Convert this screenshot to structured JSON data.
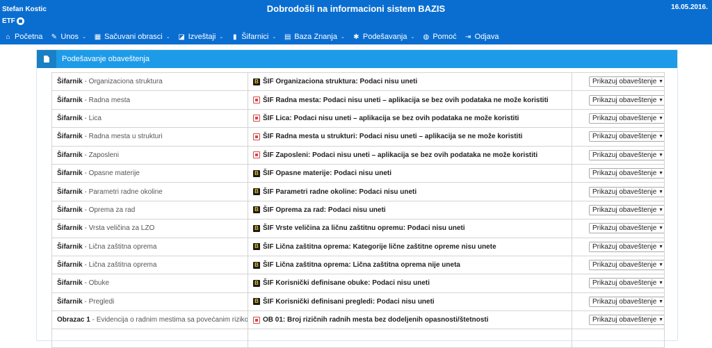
{
  "header": {
    "user_name": "Stefan Kostic",
    "org": "ETF",
    "title": "Dobrodošli na informacioni sistem BAZIS",
    "date": "16.05.2016."
  },
  "nav": [
    {
      "label": "Početna",
      "icon": "home-icon",
      "glyph": "⌂",
      "dropdown": false
    },
    {
      "label": "Unos",
      "icon": "pencil-icon",
      "glyph": "✎",
      "dropdown": true
    },
    {
      "label": "Sačuvani obrasci",
      "icon": "table-icon",
      "glyph": "▦",
      "dropdown": true
    },
    {
      "label": "Izveštaji",
      "icon": "chart-icon",
      "glyph": "◪",
      "dropdown": true
    },
    {
      "label": "Šifarnici",
      "icon": "book-icon",
      "glyph": "▮",
      "dropdown": true
    },
    {
      "label": "Baza Znanja",
      "icon": "database-icon",
      "glyph": "▤",
      "dropdown": true
    },
    {
      "label": "Podešavanja",
      "icon": "gear-icon",
      "glyph": "✱",
      "dropdown": true
    },
    {
      "label": "Pomoć",
      "icon": "globe-icon",
      "glyph": "◍",
      "dropdown": false
    },
    {
      "label": "Odjava",
      "icon": "logout-icon",
      "glyph": "⇥",
      "dropdown": false
    }
  ],
  "panel": {
    "title": "Podešavanje obaveštenja"
  },
  "rows": [
    {
      "group": "Šifarnik",
      "name": "Organizaciona struktura",
      "badge": "b",
      "message": "ŠIF Organizaciona struktura: Podaci nisu uneti",
      "option": "Prikazuj obaveštenje"
    },
    {
      "group": "Šifarnik",
      "name": "Radna mesta",
      "badge": "r",
      "message": "ŠIF Radna mesta: Podaci nisu uneti – aplikacija se bez ovih podataka ne može koristiti",
      "option": "Prikazuj obaveštenje"
    },
    {
      "group": "Šifarnik",
      "name": "Lica",
      "badge": "r",
      "message": "ŠIF Lica: Podaci nisu uneti – aplikacija se bez ovih podataka ne može koristiti",
      "option": "Prikazuj obaveštenje"
    },
    {
      "group": "Šifarnik",
      "name": "Radna mesta u strukturi",
      "badge": "r",
      "message": "ŠIF Radna mesta u strukturi: Podaci nisu uneti – aplikacija se ne može koristiti",
      "option": "Prikazuj obaveštenje"
    },
    {
      "group": "Šifarnik",
      "name": "Zaposleni",
      "badge": "r",
      "message": "ŠIF Zaposleni: Podaci nisu uneti – aplikacija se bez ovih podataka ne može koristiti",
      "option": "Prikazuj obaveštenje"
    },
    {
      "group": "Šifarnik",
      "name": "Opasne materije",
      "badge": "b",
      "message": "ŠIF Opasne materije: Podaci nisu uneti",
      "option": "Prikazuj obaveštenje"
    },
    {
      "group": "Šifarnik",
      "name": "Parametri radne okoline",
      "badge": "b",
      "message": "ŠIF Parametri radne okoline: Podaci nisu uneti",
      "option": "Prikazuj obaveštenje"
    },
    {
      "group": "Šifarnik",
      "name": "Oprema za rad",
      "badge": "b",
      "message": "ŠIF Oprema za rad: Podaci nisu uneti",
      "option": "Prikazuj obaveštenje"
    },
    {
      "group": "Šifarnik",
      "name": "Vrsta veličina za LZO",
      "badge": "b",
      "message": "ŠIF Vrste veličina za ličnu zaštitnu opremu: Podaci nisu uneti",
      "option": "Prikazuj obaveštenje"
    },
    {
      "group": "Šifarnik",
      "name": "Lična zaštitna oprema",
      "badge": "b",
      "message": "ŠIF Lična zaštitna oprema: Kategorije lične zaštitne opreme nisu unete",
      "option": "Prikazuj obaveštenje"
    },
    {
      "group": "Šifarnik",
      "name": "Lična zaštitna oprema",
      "badge": "b",
      "message": "ŠIF Lična zaštitna oprema: Lična zaštitna oprema nije uneta",
      "option": "Prikazuj obaveštenje"
    },
    {
      "group": "Šifarnik",
      "name": "Obuke",
      "badge": "b",
      "message": "ŠIF Korisnički definisane obuke: Podaci nisu uneti",
      "option": "Prikazuj obaveštenje"
    },
    {
      "group": "Šifarnik",
      "name": "Pregledi",
      "badge": "b",
      "message": "ŠIF Korisnički definisani pregledi: Podaci nisu uneti",
      "option": "Prikazuj obaveštenje"
    },
    {
      "group": "Obrazac 1",
      "name": "Evidencija o radnim mestima sa povećanim rizikom",
      "badge": "r",
      "message": "OB 01: Broj rizičnih radnih mesta bez dodeljenih opasnosti/štetnosti",
      "option": "Prikazuj obaveštenje"
    },
    {
      "group": "",
      "name": "",
      "badge": "",
      "message": "",
      "option": ""
    }
  ]
}
